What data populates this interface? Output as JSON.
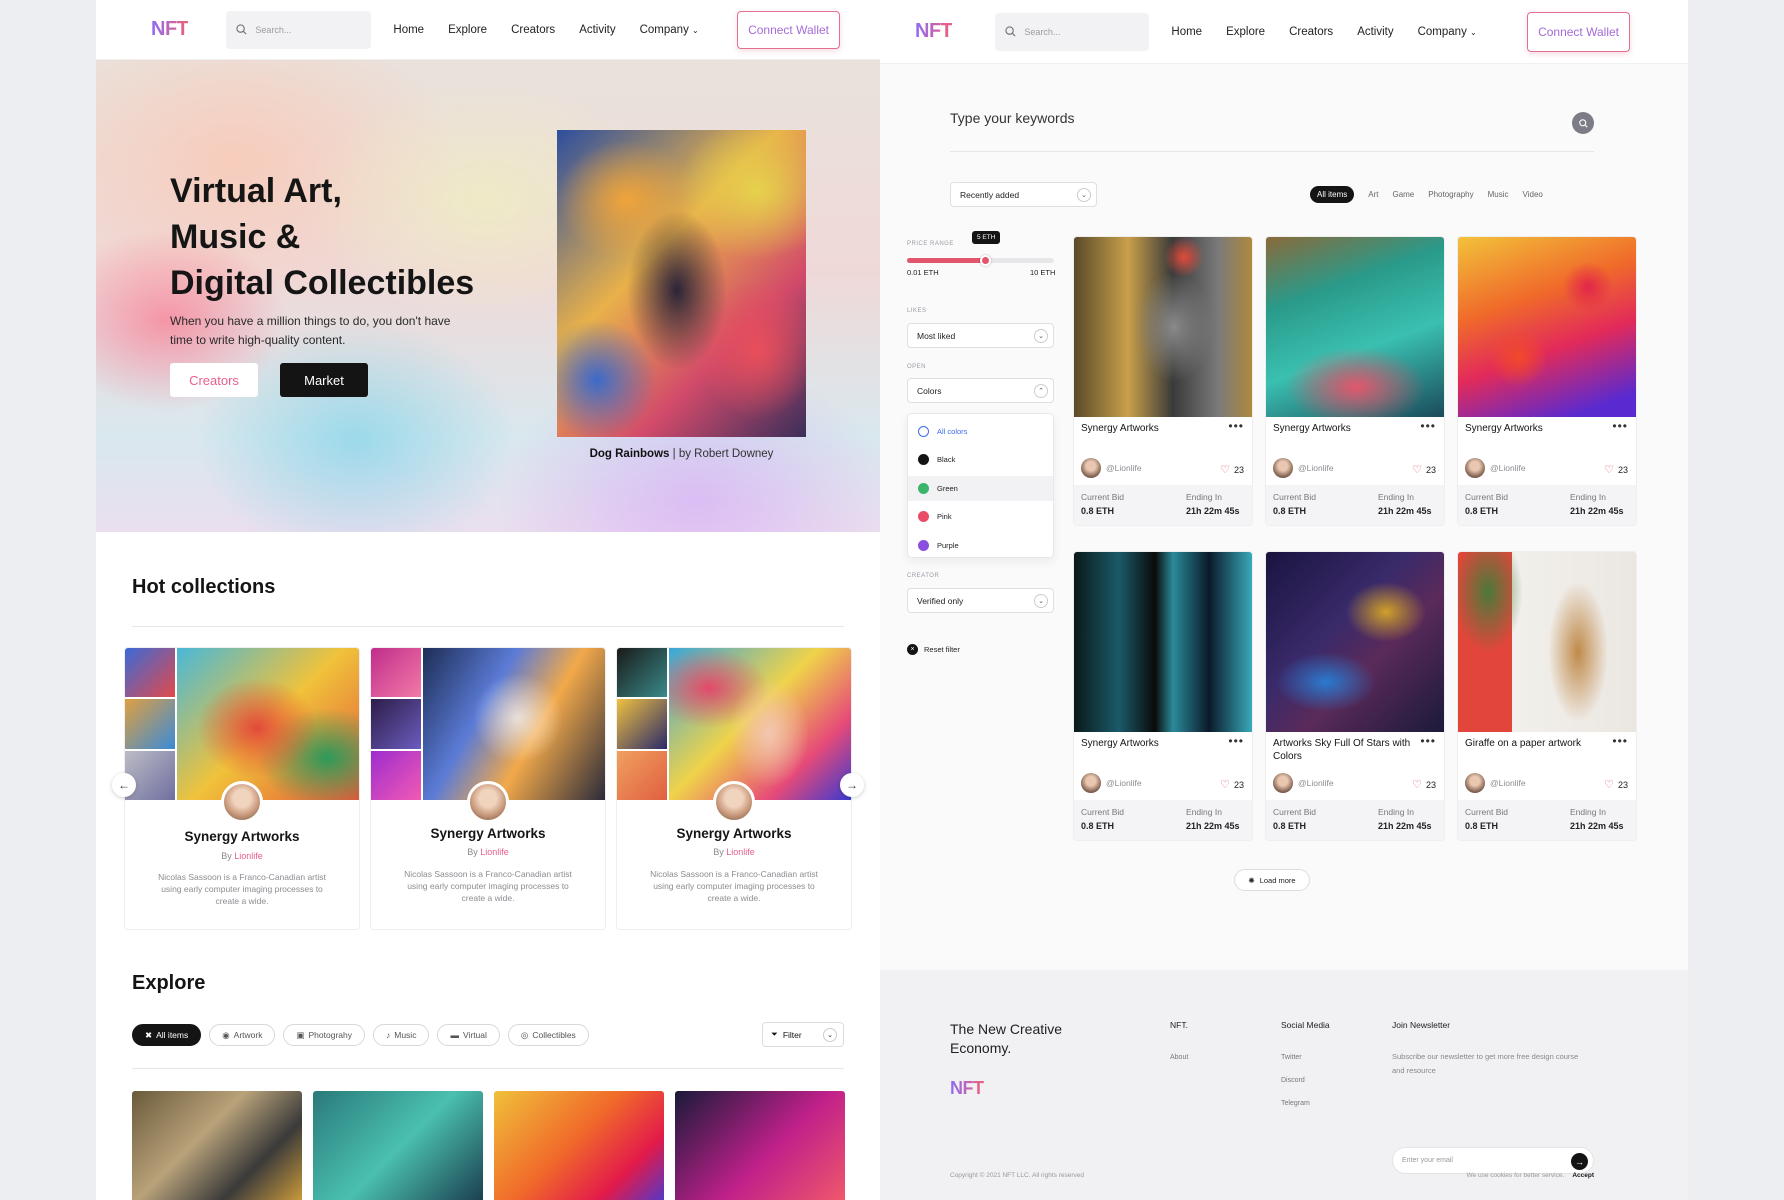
{
  "nav": {
    "logo": "NFT",
    "search_placeholder": "Search...",
    "menu": [
      "Home",
      "Explore",
      "Creators",
      "Activity",
      "Company"
    ],
    "wallet": "Connect Wallet"
  },
  "hero": {
    "title_lines": [
      "Virtual Art,",
      "Music &",
      "Digital Collectibles"
    ],
    "subtitle": "When you have a million things to do, you don't have time to write high-quality content.",
    "btn_creators": "Creators",
    "btn_market": "Market",
    "caption_title": "Dog Rainbows",
    "caption_by": "| by Robert Downey"
  },
  "hot": {
    "heading": "Hot collections",
    "cards": [
      {
        "title": "Synergy Artworks",
        "by": "By",
        "author": "Lionlife",
        "desc": "Nicolas Sassoon is a Franco-Canadian artist using early computer imaging processes to create a wide."
      },
      {
        "title": "Synergy Artworks",
        "by": "By",
        "author": "Lionlife",
        "desc": "Nicolas Sassoon is a Franco-Canadian artist using early computer imaging processes to create a wide."
      },
      {
        "title": "Synergy Artworks",
        "by": "By",
        "author": "Lionlife",
        "desc": "Nicolas Sassoon is a Franco-Canadian artist using early computer imaging processes to create a wide."
      }
    ]
  },
  "explore": {
    "heading": "Explore",
    "chips": [
      "All items",
      "Artwork",
      "Photograhy",
      "Music",
      "Virtual",
      "Collectibles"
    ],
    "filter": "Filter"
  },
  "market": {
    "keyword_placeholder": "Type your keywords",
    "sort": "Recently added",
    "tabs": [
      "All items",
      "Art",
      "Game",
      "Photography",
      "Music",
      "Video"
    ],
    "price_label": "PRICE RANGE",
    "price_tip": "5 ETH",
    "price_min": "0.01 ETH",
    "price_max": "10 ETH",
    "likes_label": "LIKES",
    "likes_value": "Most liked",
    "open_label": "OPEN",
    "open_value": "Colors",
    "colors": [
      {
        "name": "All colors",
        "color": "#3d6cf0"
      },
      {
        "name": "Black",
        "color": "#141414"
      },
      {
        "name": "Green",
        "color": "#3bb56b"
      },
      {
        "name": "Pink",
        "color": "#ea4c67"
      },
      {
        "name": "Purple",
        "color": "#8b4fe0"
      }
    ],
    "creator_label": "CREATOR",
    "creator_value": "Verified only",
    "reset": "Reset filter",
    "bid_label": "Current Bid",
    "end_label": "Ending In",
    "items": [
      {
        "name": "Synergy Artworks",
        "handle": "@Lionlife",
        "likes": "23",
        "bid": "0.8 ETH",
        "ends": "21h 22m 45s"
      },
      {
        "name": "Synergy Artworks",
        "handle": "@Lionlife",
        "likes": "23",
        "bid": "0.8 ETH",
        "ends": "21h 22m 45s"
      },
      {
        "name": "Synergy Artworks",
        "handle": "@Lionlife",
        "likes": "23",
        "bid": "0.8 ETH",
        "ends": "21h 22m 45s"
      },
      {
        "name": "Synergy Artworks",
        "handle": "@Lionlife",
        "likes": "23",
        "bid": "0.8 ETH",
        "ends": "21h 22m 45s"
      },
      {
        "name": "Artworks Sky Full Of Stars with Colors",
        "handle": "@Lionlife",
        "likes": "23",
        "bid": "0.8 ETH",
        "ends": "21h 22m 45s"
      },
      {
        "name": "Giraffe on a paper artwork",
        "handle": "@Lionlife",
        "likes": "23",
        "bid": "0.8 ETH",
        "ends": "21h 22m 45s"
      }
    ],
    "load_more": "Load more"
  },
  "footer": {
    "tagline": "The New Creative Economy.",
    "logo": "NFT",
    "col1_title": "NFT.",
    "col1_items": [
      "About"
    ],
    "col2_title": "Social Media",
    "col2_items": [
      "Twitter",
      "Discord",
      "Telegram"
    ],
    "newsletter_title": "Join Newsletter",
    "newsletter_desc": "Subscribe our newsletter to get more free design course and resource",
    "email_placeholder": "Enter your email",
    "copyright": "Copyright © 2021 NFT LLC. All rights reserved",
    "cookies": "We use cookies for better service.",
    "accept": "Accept"
  }
}
